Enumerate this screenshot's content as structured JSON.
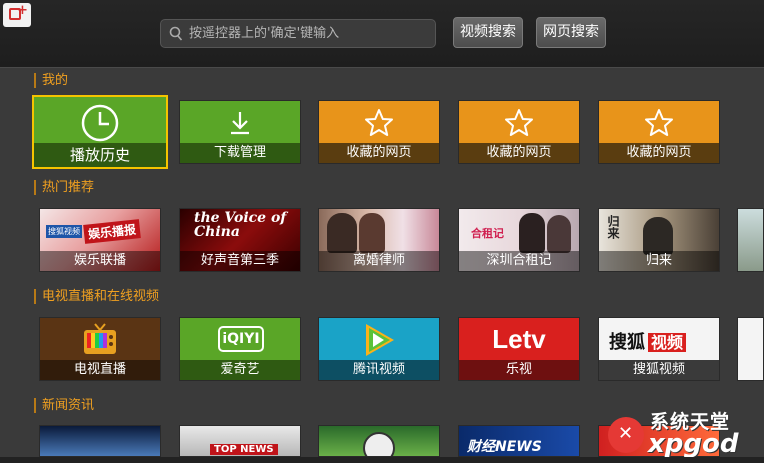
{
  "header": {
    "search": {
      "placeholder": "按遥控器上的'确定'键输入"
    },
    "video_search_label": "视频搜索",
    "web_search_label": "网页搜索"
  },
  "sections": {
    "mine": "我的",
    "hot": "热门推荐",
    "tv": "电视直播和在线视频",
    "news": "新闻资讯"
  },
  "mine_tiles": [
    {
      "label": "播放历史",
      "icon": "clock-icon"
    },
    {
      "label": "下载管理",
      "icon": "download-icon"
    },
    {
      "label": "收藏的网页",
      "icon": "star-icon"
    },
    {
      "label": "收藏的网页",
      "icon": "star-icon"
    },
    {
      "label": "收藏的网页",
      "icon": "star-icon"
    }
  ],
  "hot_tiles": [
    {
      "label": "娱乐联播",
      "badge": "搜狐视频",
      "title": "娱乐播报"
    },
    {
      "label": "好声音第三季",
      "title": "the Voice of China"
    },
    {
      "label": "离婚律师"
    },
    {
      "label": "深圳合租记",
      "title": "合租记"
    },
    {
      "label": "归来",
      "title": "归来"
    }
  ],
  "tv_tiles": [
    {
      "label": "电视直播",
      "icon": "tv-icon"
    },
    {
      "label": "爱奇艺",
      "brand": "iQIYI"
    },
    {
      "label": "腾讯视频",
      "icon": "tencent-play-icon"
    },
    {
      "label": "乐视",
      "brand": "Letv"
    },
    {
      "label": "搜狐视频",
      "brand_a": "搜狐",
      "brand_b": "视频"
    }
  ],
  "news_tiles": [
    {
      "title": "TOP NEWS"
    },
    {
      "title": "财经NEWS"
    }
  ],
  "watermark": {
    "line1": "系统天堂",
    "line2": "xpgod"
  },
  "colors": {
    "accent": "#f0a020",
    "green": "#5aa627",
    "orange": "#e8941a",
    "red": "#d9201e"
  }
}
